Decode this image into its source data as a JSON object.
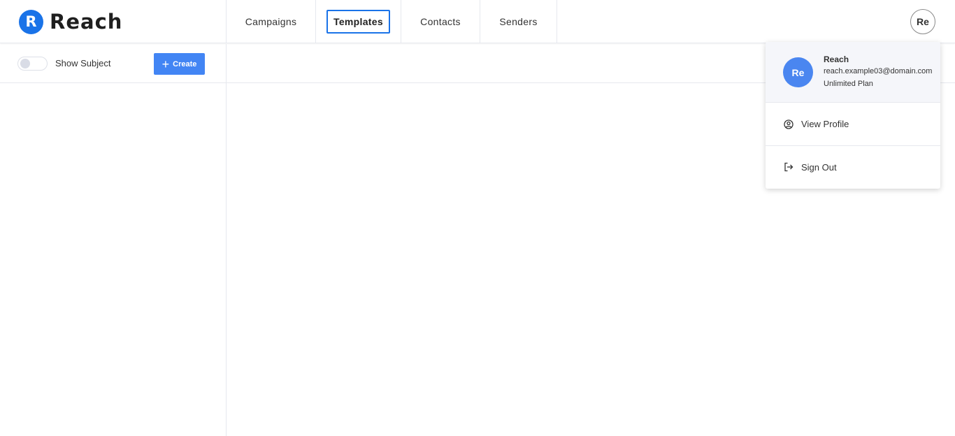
{
  "header": {
    "logo": {
      "mark": "R",
      "text": "Reach",
      "color": "#1a73e8"
    },
    "nav": {
      "tabs": [
        {
          "label": "Campaigns",
          "active": false
        },
        {
          "label": "Templates",
          "active": true
        },
        {
          "label": "Contacts",
          "active": false
        },
        {
          "label": "Senders",
          "active": false
        }
      ]
    },
    "avatar_initials": "Re"
  },
  "sidebar": {
    "toggle": {
      "label": "Show Subject",
      "checked": false
    },
    "create_button": {
      "label": "Create",
      "icon": "plus-icon",
      "color": "#4285f4"
    }
  },
  "profile_menu": {
    "avatar_initials": "Re",
    "name": "Reach",
    "email": "reach.example03@domain.com",
    "plan": "Unlimited Plan",
    "items": [
      {
        "label": "View Profile",
        "icon": "user-circle-icon"
      },
      {
        "label": "Sign Out",
        "icon": "sign-out-icon"
      }
    ]
  }
}
